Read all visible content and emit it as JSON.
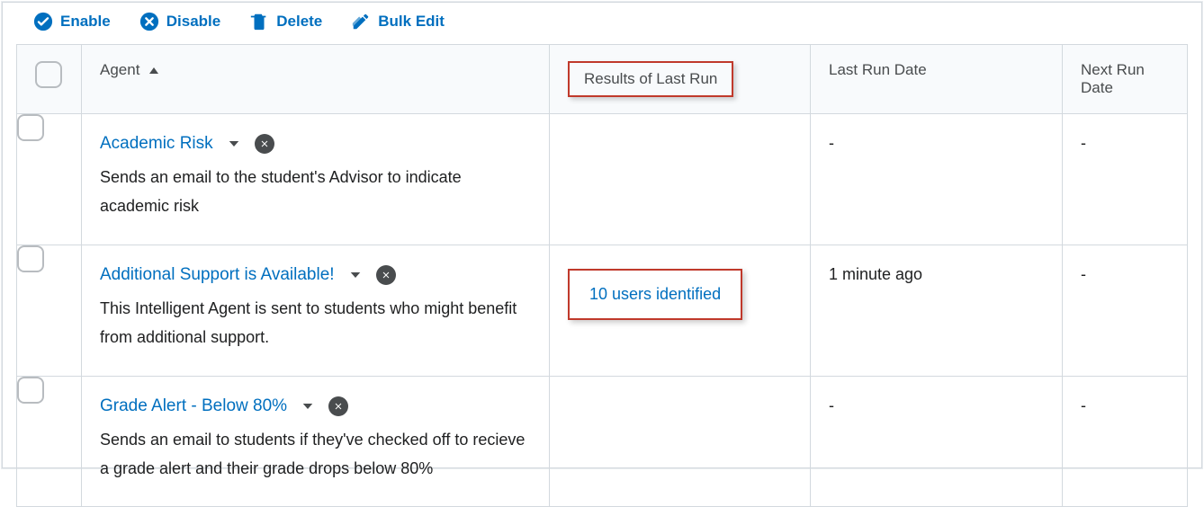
{
  "toolbar": {
    "enable": "Enable",
    "disable": "Disable",
    "delete": "Delete",
    "bulk_edit": "Bulk Edit"
  },
  "columns": {
    "agent": "Agent",
    "results": "Results of Last Run",
    "last_run": "Last Run Date",
    "next_run": "Next Run Date"
  },
  "rows": [
    {
      "name": "Academic Risk",
      "desc": "Sends an email to the student's Advisor to indicate academic risk",
      "results": "",
      "last_run": "-",
      "next_run": "-"
    },
    {
      "name": "Additional Support is Available!",
      "desc": "This Intelligent Agent is sent to students who might benefit from additional support.",
      "results": "10 users identified",
      "last_run": "1 minute ago",
      "next_run": "-"
    },
    {
      "name": "Grade Alert - Below 80%",
      "desc": "Sends an email to students if they've checked off to recieve a grade alert and their grade drops below 80%",
      "results": "",
      "last_run": "-",
      "next_run": "-"
    }
  ]
}
